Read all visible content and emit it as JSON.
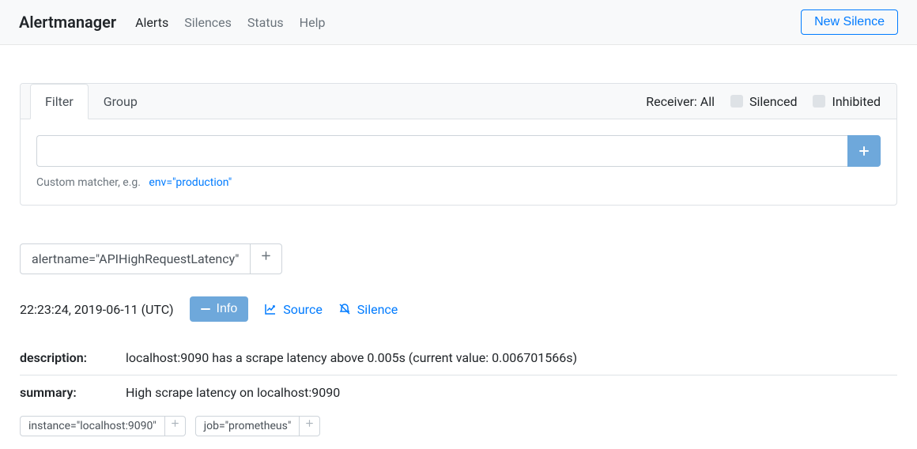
{
  "nav": {
    "brand": "Alertmanager",
    "items": [
      "Alerts",
      "Silences",
      "Status",
      "Help"
    ],
    "active_index": 0,
    "new_silence": "New Silence"
  },
  "panel": {
    "tab_filter": "Filter",
    "tab_group": "Group",
    "receiver_label": "Receiver: All",
    "silenced_label": "Silenced",
    "inhibited_label": "Inhibited",
    "hint_prefix": "Custom matcher, e.g.",
    "hint_example": "env=\"production\""
  },
  "group": {
    "label": "alertname=\"APIHighRequestLatency\""
  },
  "alert": {
    "timestamp": "22:23:24, 2019-06-11 (UTC)",
    "info_btn": "Info",
    "source_btn": "Source",
    "silence_btn": "Silence",
    "annotations": [
      {
        "key": "description:",
        "value": "localhost:9090 has a scrape latency above 0.005s (current value: 0.006701566s)"
      },
      {
        "key": "summary:",
        "value": "High scrape latency on localhost:9090"
      }
    ],
    "labels": [
      "instance=\"localhost:9090\"",
      "job=\"prometheus\""
    ]
  }
}
